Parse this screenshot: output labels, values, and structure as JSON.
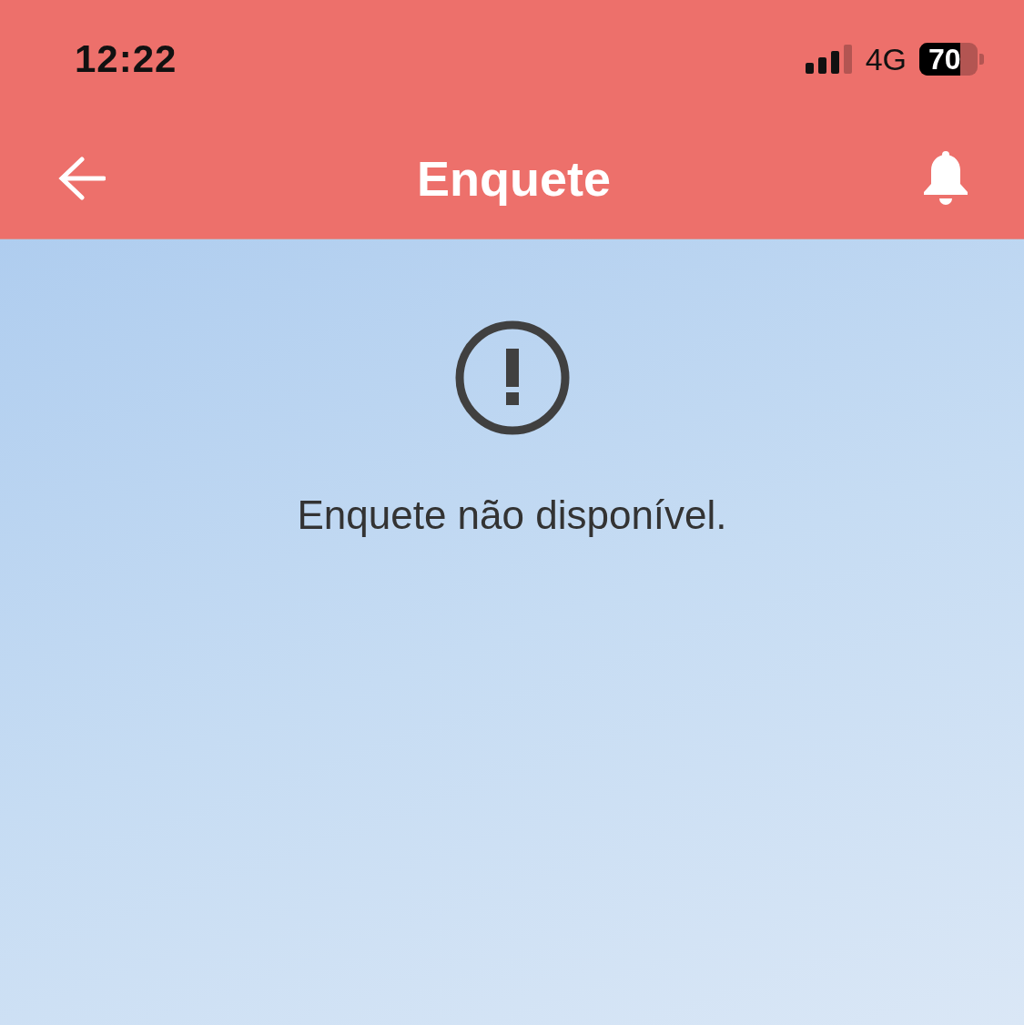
{
  "status_bar": {
    "time": "12:22",
    "network": "4G",
    "battery": "70"
  },
  "app_bar": {
    "title": "Enquete"
  },
  "message": {
    "text": "Enquete não disponível."
  }
}
